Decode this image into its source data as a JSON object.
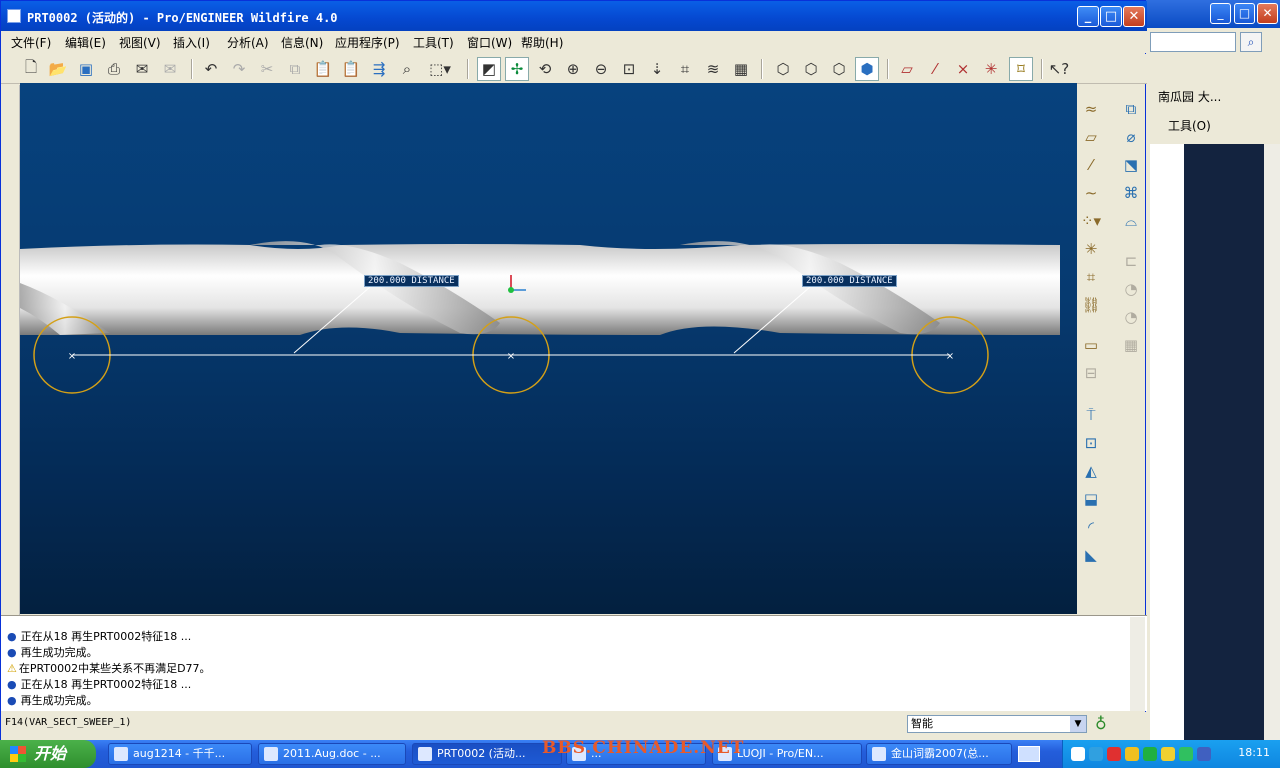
{
  "window": {
    "title": "PRT0002 (活动的) - Pro/ENGINEER Wildfire 4.0"
  },
  "menu": [
    "文件(F)",
    "编辑(E)",
    "视图(V)",
    "插入(I)",
    "分析(A)",
    "信息(N)",
    "应用程序(P)",
    "工具(T)",
    "窗口(W)",
    "帮助(H)"
  ],
  "toolbar_icons": [
    "new-icon",
    "open-icon",
    "save-icon",
    "print-icon",
    "send-icon",
    "mail-icon",
    "undo-icon",
    "redo-icon",
    "cut-icon",
    "copy-icon",
    "paste-icon",
    "paste-special-icon",
    "regenerate-icon",
    "find-icon",
    "select-box-icon",
    "datum-display-icon",
    "spin-center-icon",
    "orient-icon",
    "zoom-in-icon",
    "zoom-out-icon",
    "refit-icon",
    "reorient-icon",
    "saved-views-icon",
    "layers-icon",
    "appearance-icon",
    "wireframe-icon",
    "hidden-line-icon",
    "no-hidden-icon",
    "shading-icon",
    "plane-toggle-icon",
    "axis-toggle-icon",
    "point-toggle-icon",
    "csys-toggle-icon",
    "annotation-icon",
    "context-help-icon"
  ],
  "viewport": {
    "dim_labels": [
      "200.000  DISTANCE",
      "200.000  DISTANCE"
    ],
    "colors": {
      "bg_top": "#07427e",
      "bg_bottom": "#03203f",
      "circle": "#d4a017"
    }
  },
  "messages": [
    {
      "type": "info",
      "text": "正在从18 再生PRT0002特征18 ..."
    },
    {
      "type": "info",
      "text": "再生成功完成。"
    },
    {
      "type": "warning",
      "text": "在PRT0002中某些关系不再满足D77。"
    },
    {
      "type": "info",
      "text": "正在从18 再生PRT0002特征18 ..."
    },
    {
      "type": "info",
      "text": "再生成功完成。"
    }
  ],
  "status": {
    "feature": "F14(VAR_SECT_SWEEP_1)",
    "filter": "智能"
  },
  "background_window": {
    "link": "南瓜园 大...",
    "tools": "工具(O)"
  },
  "taskbar": {
    "start": "开始",
    "tasks": [
      "aug1214 - 千千...",
      "2011.Aug.doc - ...",
      "PRT0002 (活动...",
      "...",
      "LUOJI - Pro/EN...",
      "金山词霸2007(总..."
    ],
    "clock": "18:11"
  },
  "watermark": "BBS.CHINADE.NET"
}
